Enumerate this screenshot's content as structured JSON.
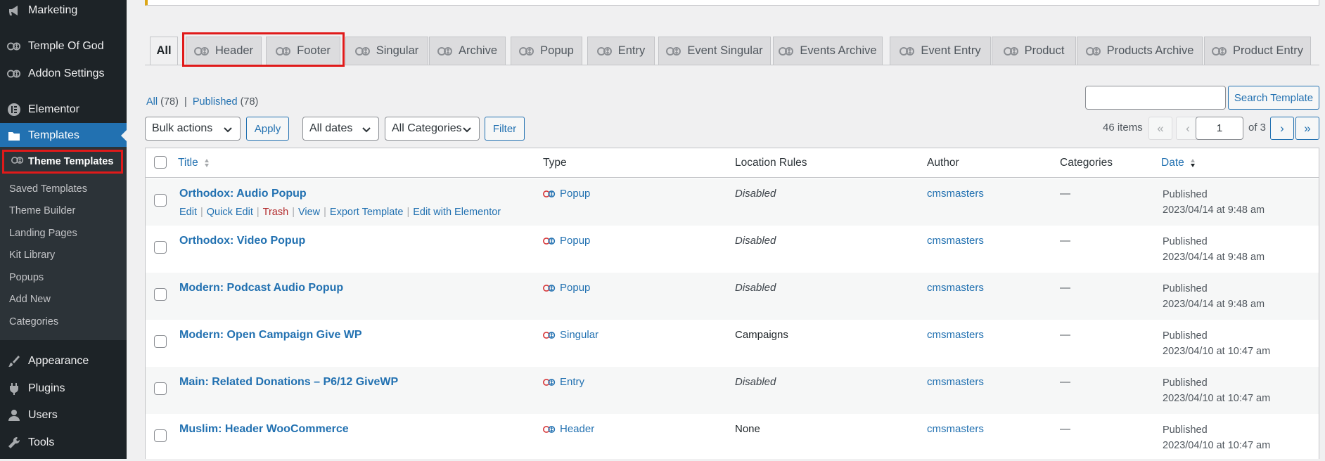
{
  "sidebar": {
    "items": [
      {
        "label": "Marketing",
        "icon": "megaphone-icon"
      },
      {
        "label": "Temple Of God",
        "icon": "cmsmasters-icon"
      },
      {
        "label": "Addon Settings",
        "icon": "cmsmasters-icon"
      },
      {
        "label": "Elementor",
        "icon": "elementor-icon"
      },
      {
        "label": "Templates",
        "icon": "folder-icon"
      },
      {
        "label": "Appearance",
        "icon": "brush-icon"
      },
      {
        "label": "Plugins",
        "icon": "plug-icon"
      },
      {
        "label": "Users",
        "icon": "user-icon"
      },
      {
        "label": "Tools",
        "icon": "wrench-icon"
      }
    ],
    "submenu": {
      "current": "Theme Templates",
      "items": [
        "Saved Templates",
        "Theme Builder",
        "Landing Pages",
        "Kit Library",
        "Popups",
        "Add New",
        "Categories"
      ]
    }
  },
  "tabs": [
    "All",
    "Header",
    "Footer",
    "Singular",
    "Archive",
    "Popup",
    "Entry",
    "Event Singular",
    "Events Archive",
    "Event Entry",
    "Product",
    "Products Archive",
    "Product Entry"
  ],
  "views": {
    "all_label": "All",
    "all_count": "(78)",
    "published_label": "Published",
    "published_count": "(78)"
  },
  "search": {
    "button": "Search Template",
    "value": ""
  },
  "filters": {
    "bulk_actions": "Bulk actions",
    "apply": "Apply",
    "dates": "All dates",
    "categories": "All Categories",
    "filter": "Filter"
  },
  "pagination": {
    "items": "46 items",
    "first": "«",
    "prev": "‹",
    "current": "1",
    "of": "of 3",
    "next": "›",
    "last": "»"
  },
  "table": {
    "columns": {
      "title": "Title",
      "type": "Type",
      "location": "Location Rules",
      "author": "Author",
      "categories": "Categories",
      "date": "Date"
    },
    "row_actions": {
      "edit": "Edit",
      "quick_edit": "Quick Edit",
      "trash": "Trash",
      "view": "View",
      "export": "Export Template",
      "elementor": "Edit with Elementor"
    },
    "rows": [
      {
        "title": "Orthodox: Audio Popup",
        "type": "Popup",
        "location": "Disabled",
        "author": "cmsmasters",
        "categories": "—",
        "status": "Published",
        "date": "2023/04/14 at 9:48 am"
      },
      {
        "title": "Orthodox: Video Popup",
        "type": "Popup",
        "location": "Disabled",
        "author": "cmsmasters",
        "categories": "—",
        "status": "Published",
        "date": "2023/04/14 at 9:48 am"
      },
      {
        "title": "Modern: Podcast Audio Popup",
        "type": "Popup",
        "location": "Disabled",
        "author": "cmsmasters",
        "categories": "—",
        "status": "Published",
        "date": "2023/04/14 at 9:48 am"
      },
      {
        "title": "Modern: Open Campaign Give WP",
        "type": "Singular",
        "location": "Campaigns",
        "author": "cmsmasters",
        "categories": "—",
        "status": "Published",
        "date": "2023/04/10 at 10:47 am"
      },
      {
        "title": "Main: Related Donations – P6/12 GiveWP",
        "type": "Entry",
        "location": "Disabled",
        "author": "cmsmasters",
        "categories": "—",
        "status": "Published",
        "date": "2023/04/10 at 10:47 am"
      },
      {
        "title": "Muslim: Header WooCommerce",
        "type": "Header",
        "location": "None",
        "author": "cmsmasters",
        "categories": "—",
        "status": "Published",
        "date": "2023/04/10 at 10:47 am"
      }
    ]
  },
  "colors": {
    "accent": "#2271b1",
    "sidebar": "#1d2327",
    "highlight": "#e01a1a",
    "trash": "#b32d2e"
  }
}
